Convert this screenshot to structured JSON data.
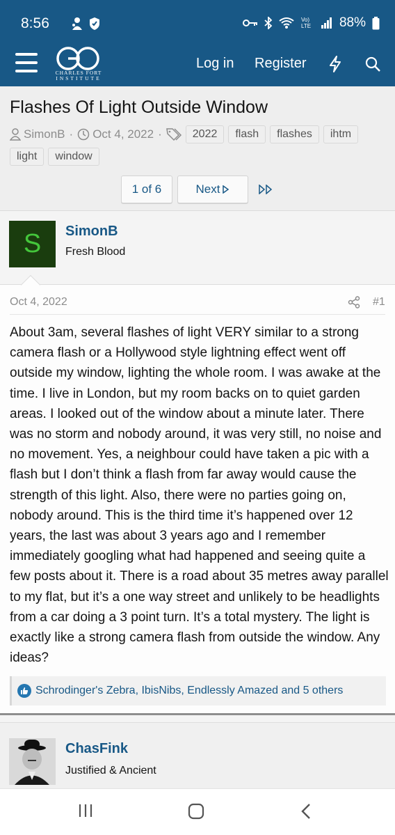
{
  "status_bar": {
    "time": "8:56",
    "battery": "88%",
    "left_icons": [
      "notification-icon",
      "shield-icon"
    ],
    "right_icons": [
      "key-icon",
      "bluetooth-icon",
      "wifi-icon",
      "volte-icon",
      "signal-icon",
      "battery-icon"
    ],
    "volte_label": "Vo)\nLTE"
  },
  "header": {
    "logo_text": "CHARLES FORT INSTITUTE",
    "logo_line1": "CHARLES FORT",
    "logo_line2": "INSTITUTE",
    "login_label": "Log in",
    "register_label": "Register",
    "icons": [
      "menu-icon",
      "bolt-icon",
      "search-icon"
    ],
    "brand_color": "#185886"
  },
  "thread": {
    "title": "Flashes Of Light Outside Window",
    "author": "SimonB",
    "date": "Oct 4, 2022",
    "separator": "·",
    "tags": [
      "2022",
      "flash",
      "flashes",
      "ihtm",
      "light",
      "window"
    ]
  },
  "pagination": {
    "current": "1 of 6",
    "next_label": "Next",
    "next_glyph": "▷",
    "last_icon": "double-chevron-right-icon"
  },
  "posts": [
    {
      "avatar_letter": "S",
      "username": "SimonB",
      "user_title": "Fresh Blood",
      "date": "Oct 4, 2022",
      "post_number": "#1",
      "body": "About 3am, several flashes of light VERY similar to a strong camera flash or a Hollywood style lightning effect went off outside my window, lighting the whole room. I was awake at the time. I live in London, but my room backs on to quiet garden areas. I looked out of the window about a minute later. There was no storm and nobody around, it was very still, no noise and no movement. Yes, a neighbour could have taken a pic with a flash but I don’t think a flash from far away would cause the strength of this light. Also, there were no parties going on, nobody around. This is the third time it’s happened over 12 years, the last was about 3 years ago and I remember immediately googling what had happened and seeing quite a few posts about it. There is a road about 35 metres away parallel to my flat, but it’s a one way street and unlikely to be headlights from a car doing a 3 point turn. It’s a total mystery. The light is exactly like a strong camera flash from outside the window. Any ideas?",
      "reactions": "Schrodinger's Zebra, IbisNibs, Endlessly Amazed and 5 others"
    },
    {
      "username": "ChasFink",
      "user_title": "Justified & Ancient"
    }
  ],
  "android_nav": {
    "icons": [
      "recent-apps-icon",
      "home-icon",
      "back-icon"
    ]
  }
}
